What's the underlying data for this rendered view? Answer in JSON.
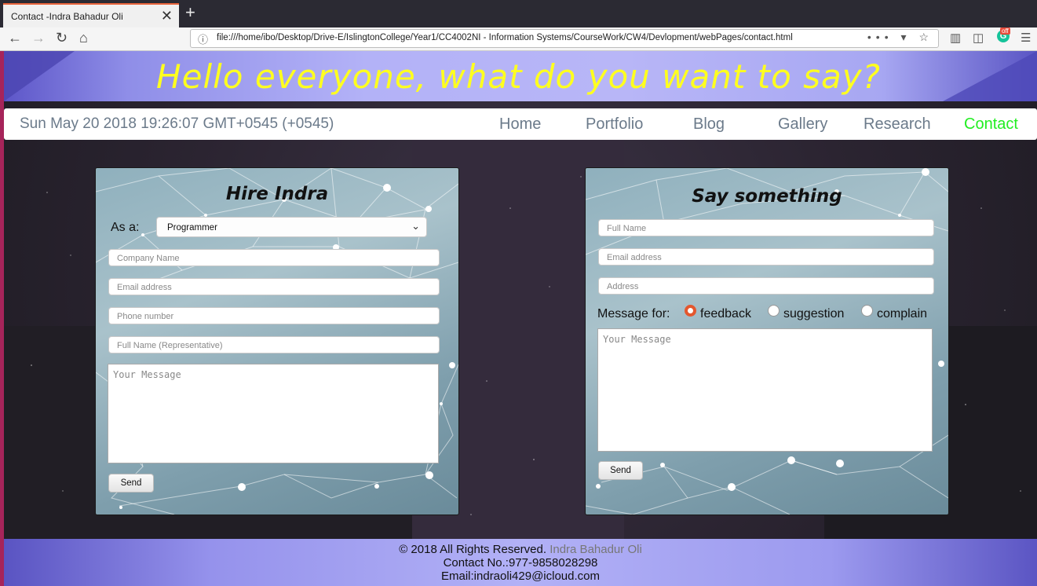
{
  "browser": {
    "tab_title": "Contact -Indra Bahadur Oli",
    "url": "file:///home/ibo/Desktop/Drive-E/IslingtonCollege/Year1/CC4002NI - Information Systems/CourseWork/CW4/Devlopment/webPages/contact.html",
    "grammarly_badge": "off"
  },
  "header": {
    "title": "Hello everyone, what do you want to say?"
  },
  "nav": {
    "datetime": "Sun May 20 2018 19:26:07 GMT+0545 (+0545)",
    "items": [
      "Home",
      "Portfolio",
      "Blog",
      "Gallery",
      "Research",
      "Contact"
    ],
    "active": "Contact",
    "active_color": "#22ee22"
  },
  "hire_form": {
    "title": "Hire Indra",
    "as_label": "As a:",
    "as_value": "Programmer",
    "company_placeholder": "Company Name",
    "email_placeholder": "Email address",
    "phone_placeholder": "Phone number",
    "name_placeholder": "Full Name (Representative)",
    "message_placeholder": "Your Message",
    "send": "Send"
  },
  "say_form": {
    "title": "Say something",
    "name_placeholder": "Full Name",
    "email_placeholder": "Email address",
    "address_placeholder": "Address",
    "message_for_label": "Message for:",
    "options": [
      "feedback",
      "suggestion",
      "complain"
    ],
    "selected": "feedback",
    "message_placeholder": "Your Message",
    "send": "Send"
  },
  "footer": {
    "copyright": "© 2018 All Rights Reserved.",
    "author": "Indra Bahadur Oli",
    "contact": "Contact No.:977-9858028298",
    "email": "Email:indraoli429@icloud.com"
  }
}
